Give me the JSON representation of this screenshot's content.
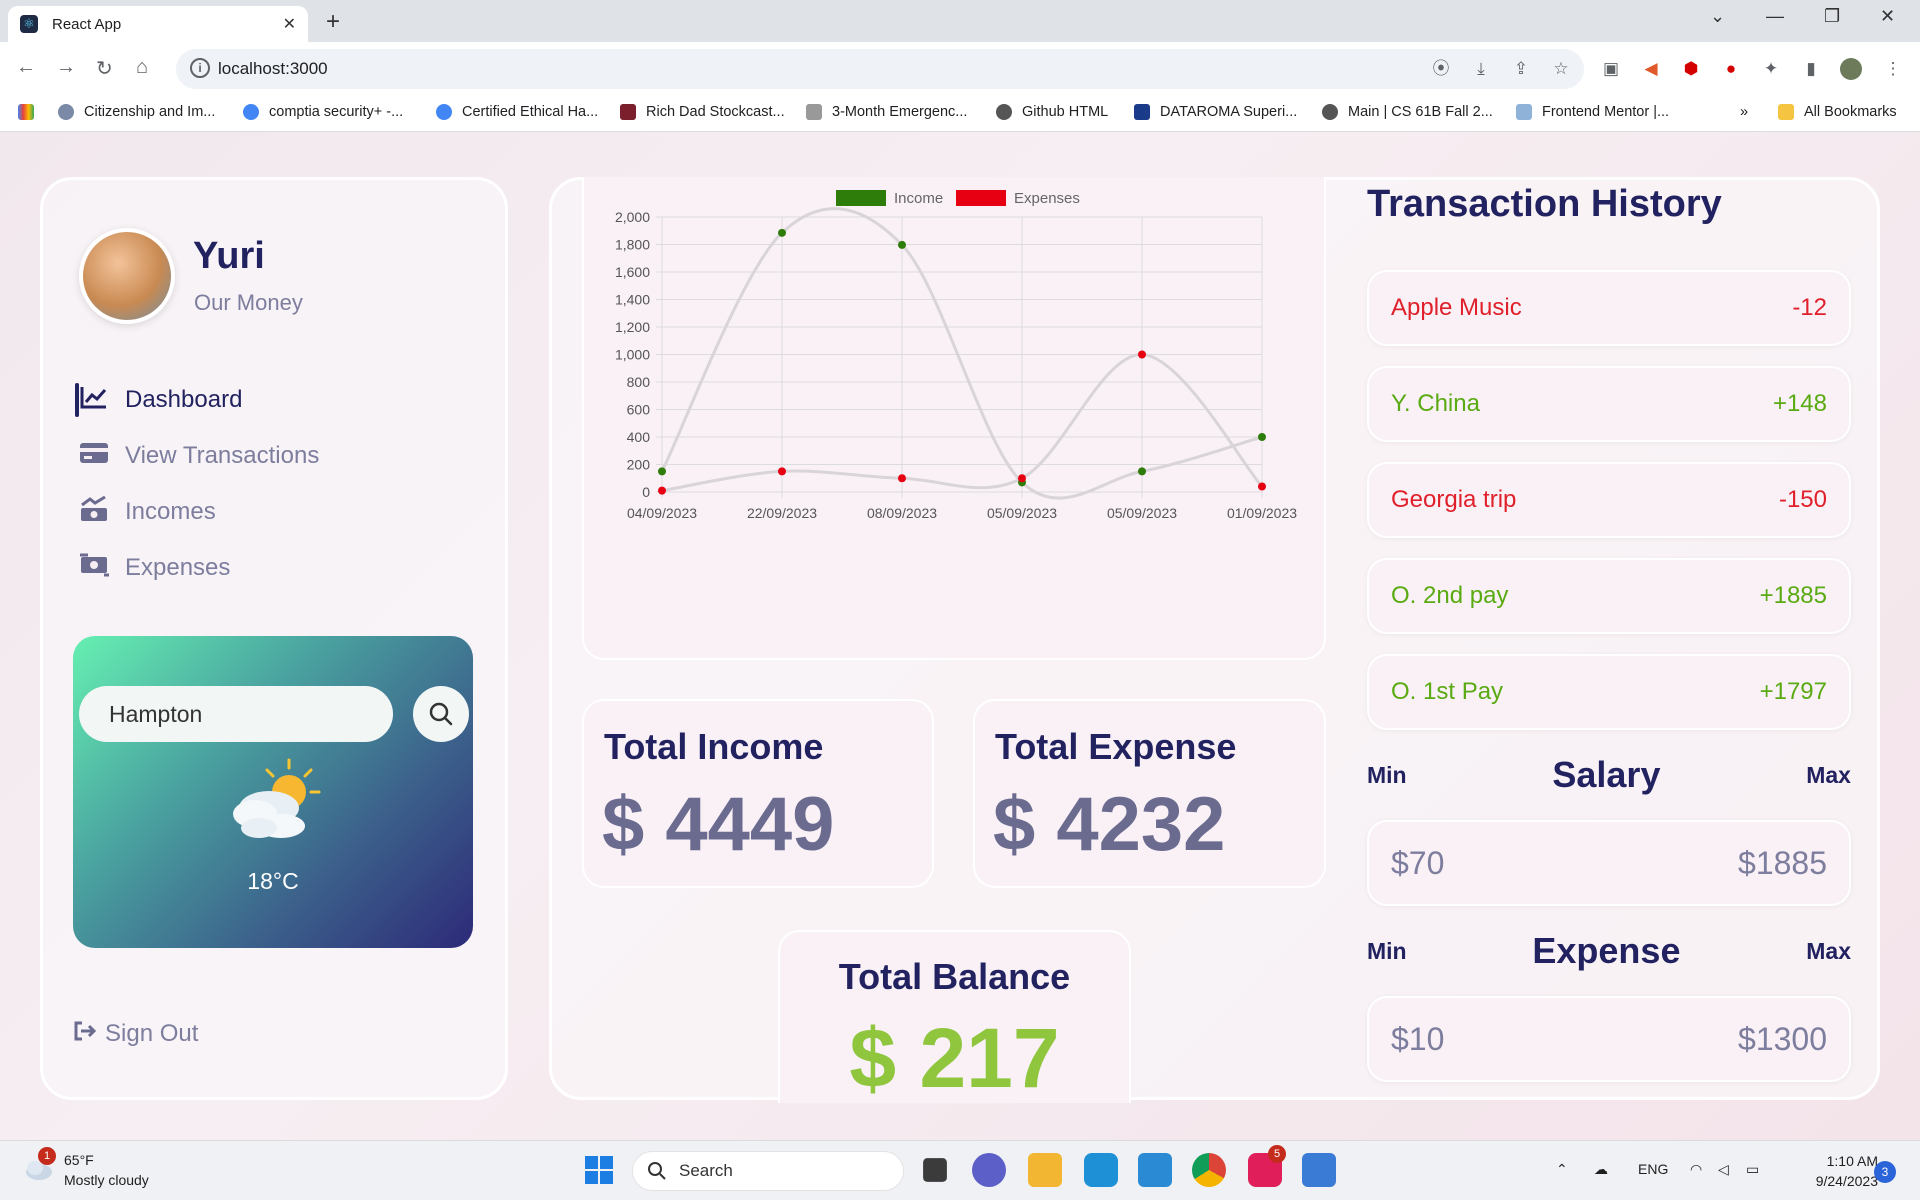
{
  "browser": {
    "tab_title": "React App",
    "url": "localhost:3000",
    "bookmarks": [
      "Citizenship and Im...",
      "comptia security+ -...",
      "Certified Ethical Ha...",
      "Rich Dad Stockcast...",
      "3-Month Emergenc...",
      "Github HTML",
      "DATAROMA Superi...",
      "Main | CS 61B Fall 2...",
      "Frontend Mentor |..."
    ],
    "more_bookmarks": "»",
    "all_bookmarks": "All Bookmarks"
  },
  "user": {
    "name": "Yuri",
    "subtitle": "Our Money"
  },
  "menu": [
    {
      "label": "Dashboard",
      "icon": "chart-line-icon",
      "active": true
    },
    {
      "label": "View Transactions",
      "icon": "credit-card-icon",
      "active": false
    },
    {
      "label": "Incomes",
      "icon": "money-bill-trend-icon",
      "active": false
    },
    {
      "label": "Expenses",
      "icon": "money-bill-transfer-icon",
      "active": false
    }
  ],
  "weather": {
    "city": "Hampton",
    "temperature": "18°C",
    "icon": "partly-cloudy-icon"
  },
  "sign_out": "Sign Out",
  "chart_data": {
    "type": "line",
    "categories": [
      "04/09/2023",
      "22/09/2023",
      "08/09/2023",
      "05/09/2023",
      "05/09/2023",
      "01/09/2023"
    ],
    "series": [
      {
        "name": "Income",
        "color": "#2e7d0a",
        "values": [
          150,
          1885,
          1797,
          70,
          150,
          400
        ]
      },
      {
        "name": "Expenses",
        "color": "#e60012",
        "values": [
          10,
          150,
          100,
          100,
          1000,
          40
        ]
      }
    ],
    "ylim": [
      0,
      2000
    ],
    "yticks": [
      0,
      200,
      400,
      600,
      800,
      1000,
      1200,
      1400,
      1600,
      1800,
      2000
    ],
    "ytick_labels": [
      "0",
      "200",
      "400",
      "600",
      "800",
      "1,000",
      "1,200",
      "1,400",
      "1,600",
      "1,800",
      "2,000"
    ],
    "legend_position": "top-center",
    "grid": true
  },
  "stats": {
    "income_label": "Total Income",
    "income_value": "$ 4449",
    "expense_label": "Total Expense",
    "expense_value": "$ 4232",
    "balance_label": "Total Balance",
    "balance_value": "$ 217"
  },
  "history": {
    "title": "Transaction History",
    "items": [
      {
        "name": "Apple Music",
        "amount": "-12",
        "color": "#e0202b"
      },
      {
        "name": "Y. China",
        "amount": "+148",
        "color": "#5aaa12"
      },
      {
        "name": "Georgia trip",
        "amount": "-150",
        "color": "#e0202b"
      },
      {
        "name": "O. 2nd pay",
        "amount": "+1885",
        "color": "#5aaa12"
      },
      {
        "name": "O. 1st Pay",
        "amount": "+1797",
        "color": "#5aaa12"
      }
    ]
  },
  "salary": {
    "min_label": "Min",
    "title": "Salary",
    "max_label": "Max",
    "min": "$70",
    "max": "$1885"
  },
  "expense_range": {
    "min_label": "Min",
    "title": "Expense",
    "max_label": "Max",
    "min": "$10",
    "max": "$1300"
  },
  "taskbar": {
    "temp": "65°F",
    "condition": "Mostly cloudy",
    "weather_badge": "1",
    "search": "Search",
    "lang": "ENG",
    "time": "1:10 AM",
    "date": "9/24/2023",
    "notifications": "3",
    "slack_badge": "5"
  },
  "colors": {
    "primary": "#222260",
    "muted": "#7d7d9e",
    "income": "#5aaa12",
    "expense": "#e0202b"
  }
}
